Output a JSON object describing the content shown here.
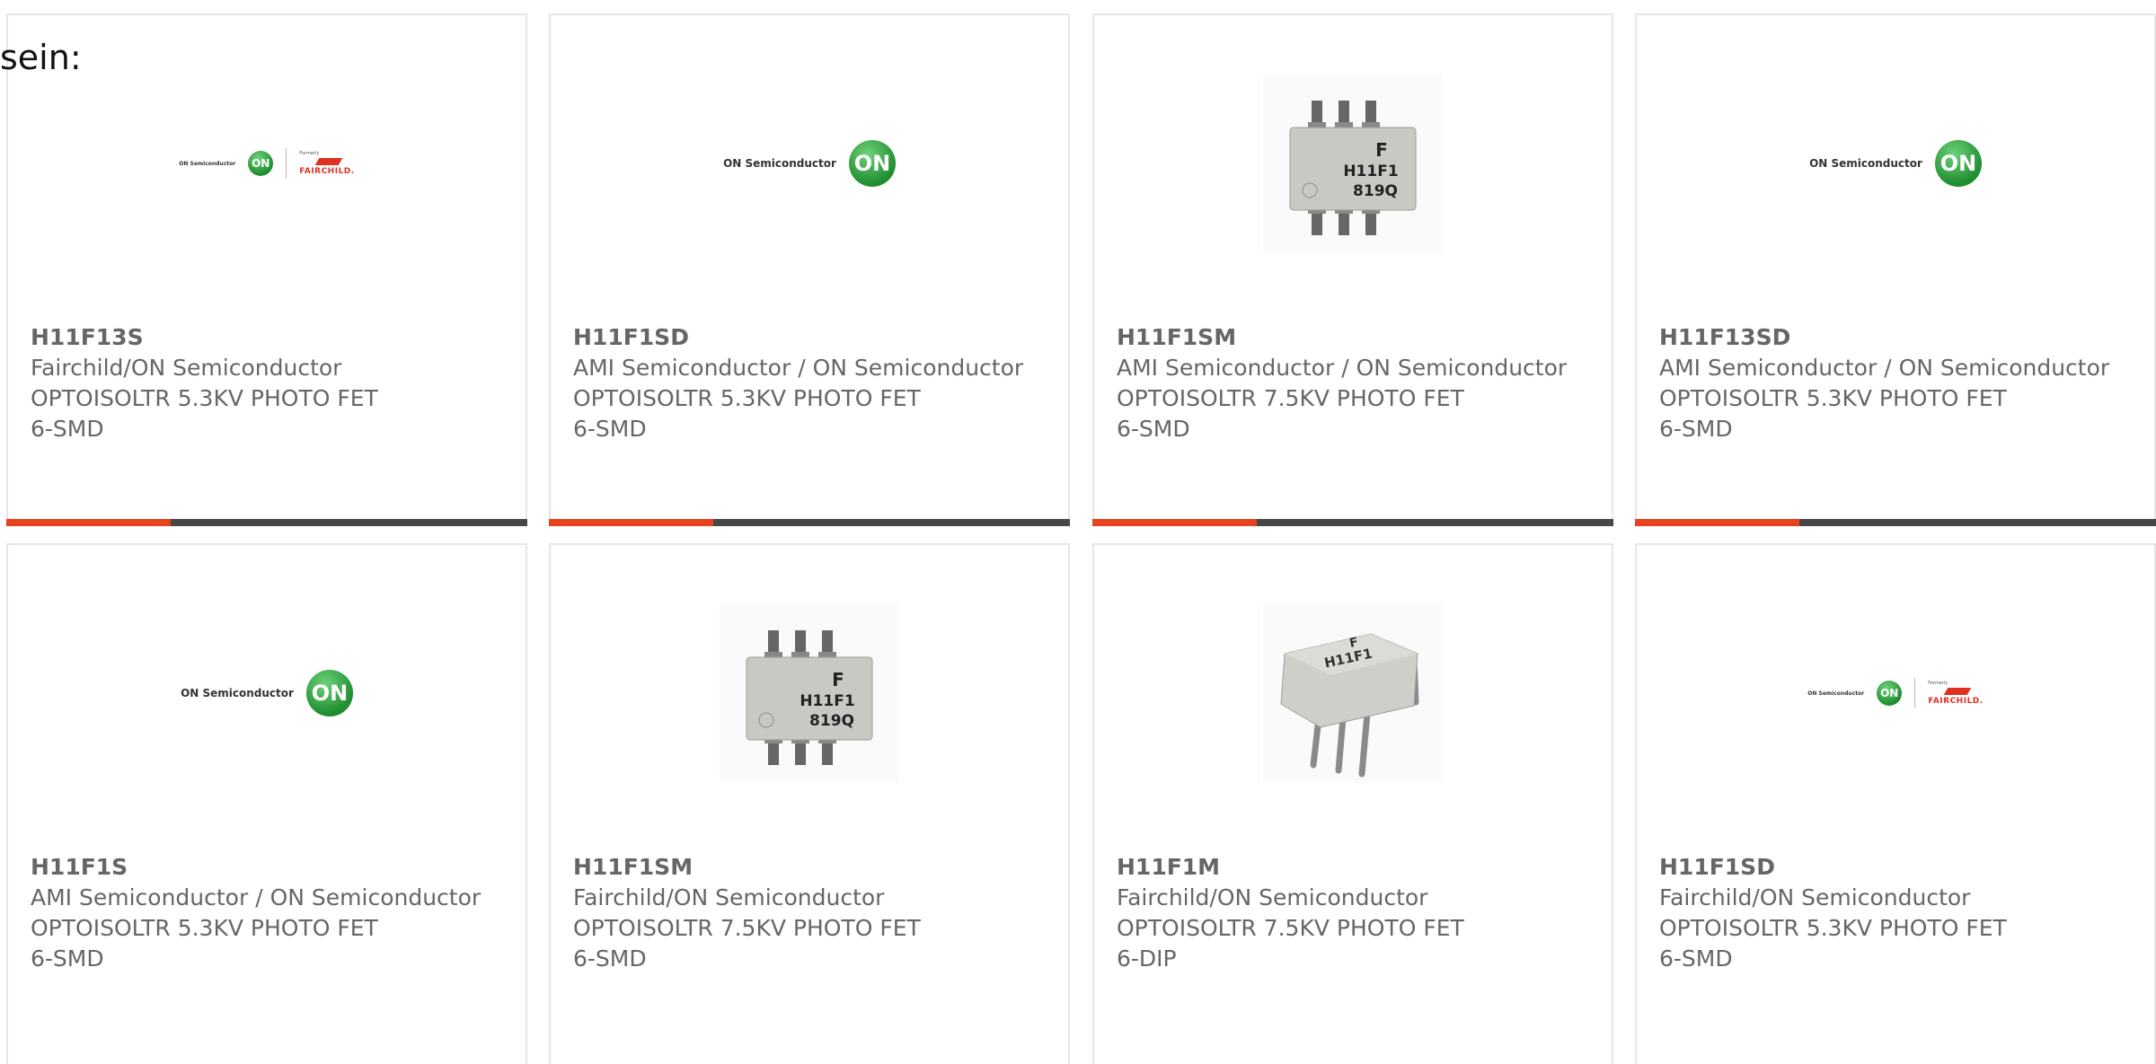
{
  "heading": "sein:",
  "colors": {
    "accent": "#e8411e",
    "bar": "#474747",
    "border": "#e6e6e6",
    "text": "#666666"
  },
  "products": [
    {
      "part": "H11F13S",
      "manufacturer": "Fairchild/ON Semiconductor",
      "description": "OPTOISOLTR 5.3KV PHOTO FET",
      "package": "6-SMD",
      "image": "on-fairchild-logo",
      "logo_text": "ON Semiconductor",
      "logo_disk": "ON",
      "logo_formerly": "Formerly",
      "logo_brand": "FAIRCHILD."
    },
    {
      "part": "H11F1SD",
      "manufacturer": "AMI Semiconductor / ON Semiconductor",
      "description": "OPTOISOLTR 5.3KV PHOTO FET",
      "package": "6-SMD",
      "image": "on-semiconductor-logo",
      "logo_text": "ON Semiconductor",
      "logo_disk": "ON"
    },
    {
      "part": "H11F1SM",
      "manufacturer": "AMI Semiconductor / ON Semiconductor",
      "description": "OPTOISOLTR 7.5KV PHOTO FET",
      "package": "6-SMD",
      "image": "smd-chip-photo",
      "chip_text1": "H11F1",
      "chip_text2": "819Q"
    },
    {
      "part": "H11F13SD",
      "manufacturer": "AMI Semiconductor / ON Semiconductor",
      "description": "OPTOISOLTR 5.3KV PHOTO FET",
      "package": "6-SMD",
      "image": "on-semiconductor-logo",
      "logo_text": "ON Semiconductor",
      "logo_disk": "ON"
    },
    {
      "part": "H11F1S",
      "manufacturer": "AMI Semiconductor / ON Semiconductor",
      "description": "OPTOISOLTR 5.3KV PHOTO FET",
      "package": "6-SMD",
      "image": "on-semiconductor-logo",
      "logo_text": "ON Semiconductor",
      "logo_disk": "ON"
    },
    {
      "part": "H11F1SM",
      "manufacturer": "Fairchild/ON Semiconductor",
      "description": "OPTOISOLTR 7.5KV PHOTO FET",
      "package": "6-SMD",
      "image": "smd-chip-photo",
      "chip_text1": "H11F1",
      "chip_text2": "819Q"
    },
    {
      "part": "H11F1M",
      "manufacturer": "Fairchild/ON Semiconductor",
      "description": "OPTOISOLTR 7.5KV PHOTO FET",
      "package": "6-DIP",
      "image": "dip-chip-photo",
      "chip_text1": "H11F1"
    },
    {
      "part": "H11F1SD",
      "manufacturer": "Fairchild/ON Semiconductor",
      "description": "OPTOISOLTR 5.3KV PHOTO FET",
      "package": "6-SMD",
      "image": "on-fairchild-logo",
      "logo_text": "ON Semiconductor",
      "logo_disk": "ON",
      "logo_formerly": "Formerly",
      "logo_brand": "FAIRCHILD."
    }
  ]
}
